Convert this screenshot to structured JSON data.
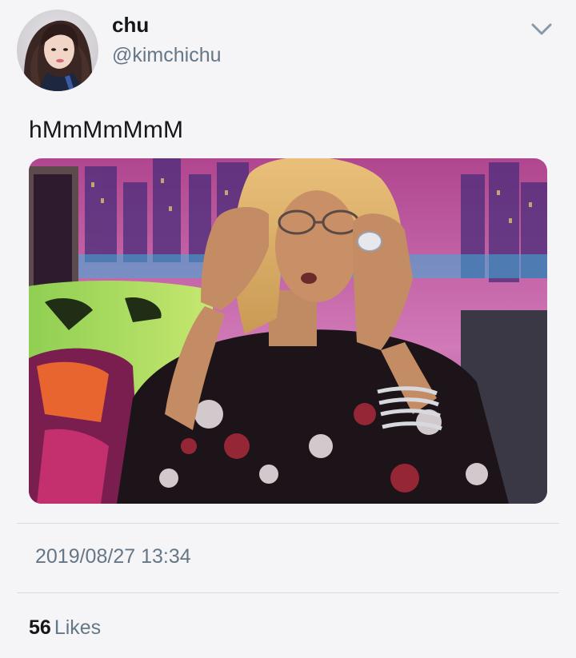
{
  "author": {
    "display_name": "chu",
    "handle": "@kimchichu"
  },
  "tweet": {
    "text": "hMmMmMmM",
    "timestamp": "2019/08/27 13:34"
  },
  "stats": {
    "likes_count": "56",
    "likes_label": "Likes"
  },
  "icons": {
    "menu": "chevron-down-icon"
  },
  "colors": {
    "background": "#f5f5f7",
    "primary_text": "#14171a",
    "secondary_text": "#657786",
    "divider": "#d6dbe0"
  }
}
